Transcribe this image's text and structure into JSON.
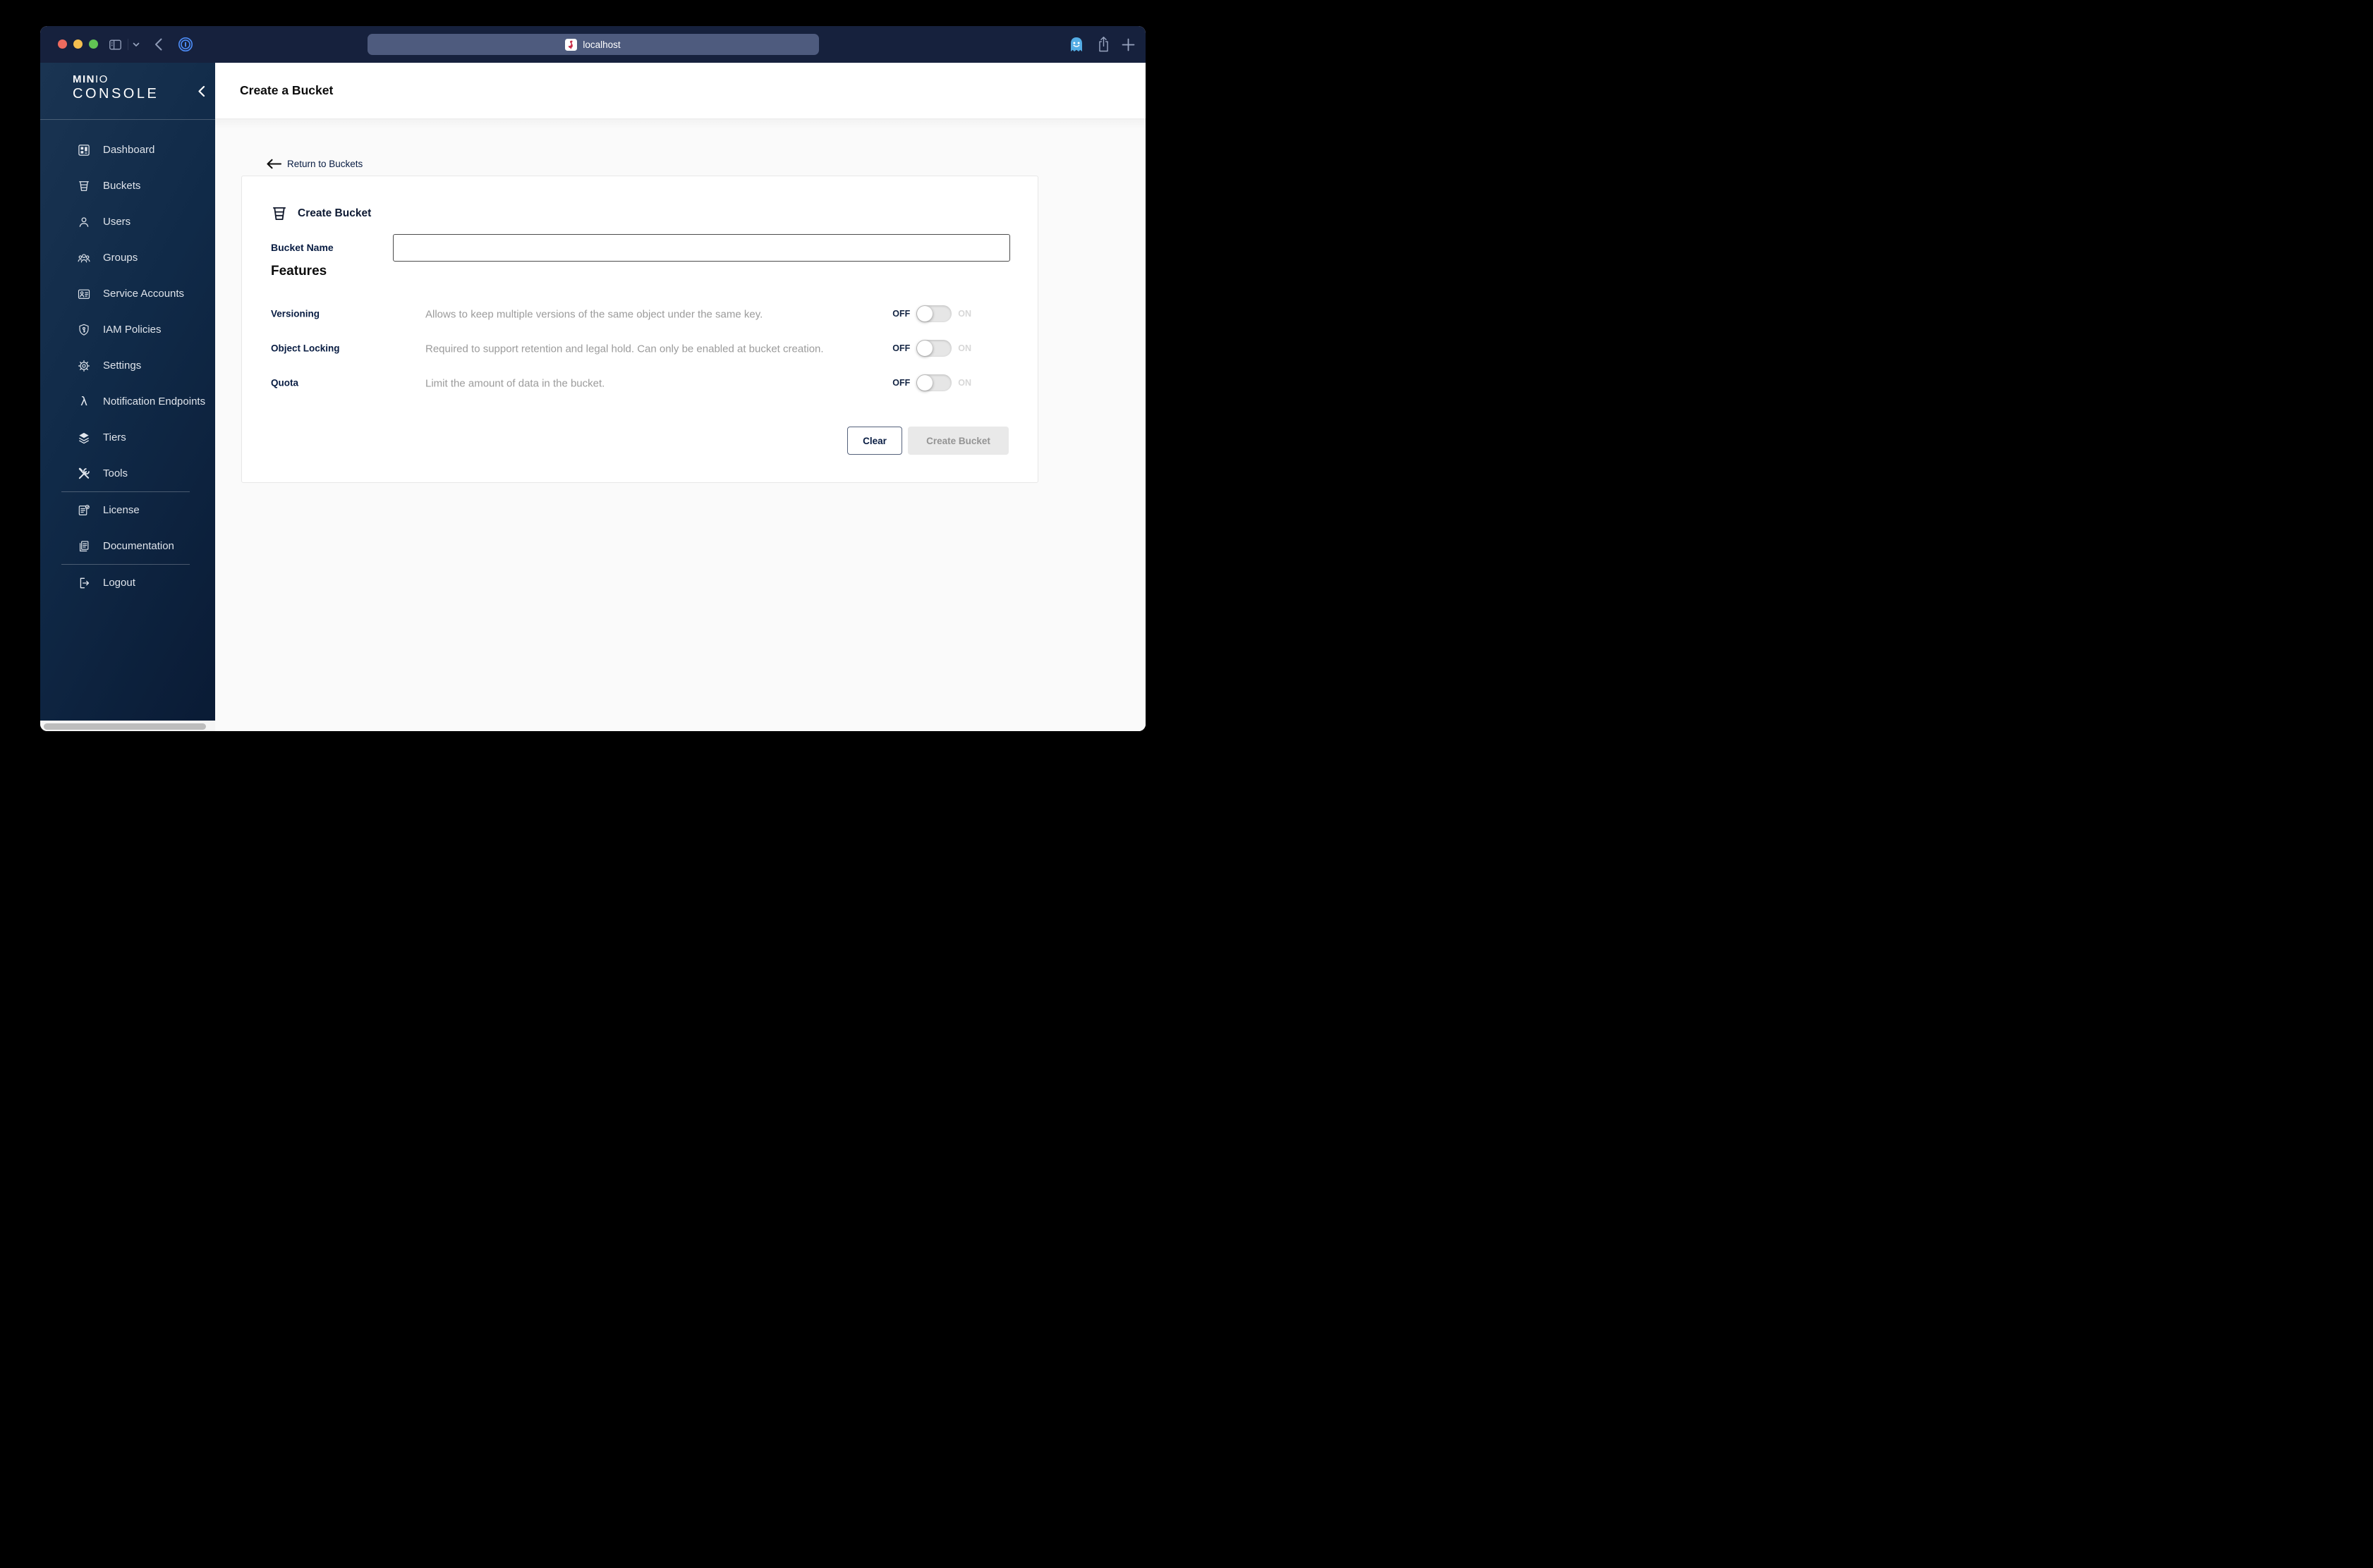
{
  "browser": {
    "address": "localhost",
    "icons": [
      "sidebar-toggle-icon",
      "chevron-down-icon",
      "back-icon",
      "onepassword-icon",
      "site-favicon",
      "ghostery-icon",
      "share-icon",
      "new-tab-icon"
    ],
    "window_controls": [
      "close",
      "minimize",
      "zoom"
    ]
  },
  "colors": {
    "navy": "#081C42",
    "minio_red": "#C72E49",
    "titlebar": "#16213D",
    "sidebar_gradient_start": "#1A3452",
    "sidebar_gradient_end": "#0A1B35",
    "content_bg": "#FAFAFA",
    "disabled_button_bg": "#E9E9E9",
    "description_gray": "#9B9B9B"
  },
  "sidebar": {
    "logo": {
      "brand_bold": "MIN",
      "brand_light": "IO",
      "product": "CONSOLE"
    },
    "items": [
      {
        "label": "Dashboard",
        "icon": "dashboard-icon"
      },
      {
        "label": "Buckets",
        "icon": "buckets-icon"
      },
      {
        "label": "Users",
        "icon": "users-icon"
      },
      {
        "label": "Groups",
        "icon": "groups-icon"
      },
      {
        "label": "Service Accounts",
        "icon": "service-accounts-icon"
      },
      {
        "label": "IAM Policies",
        "icon": "iam-policies-icon"
      },
      {
        "label": "Settings",
        "icon": "settings-icon"
      },
      {
        "label": "Notification Endpoints",
        "icon": "notification-endpoints-icon"
      },
      {
        "label": "Tiers",
        "icon": "tiers-icon"
      },
      {
        "label": "Tools",
        "icon": "tools-icon"
      },
      {
        "label": "License",
        "icon": "license-icon"
      },
      {
        "label": "Documentation",
        "icon": "documentation-icon"
      },
      {
        "label": "Logout",
        "icon": "logout-icon"
      }
    ]
  },
  "header": {
    "title": "Create a Bucket"
  },
  "page": {
    "back_link": "Return to Buckets",
    "card": {
      "title": "Create Bucket",
      "bucket_name_label": "Bucket Name",
      "bucket_name_value": "",
      "features_heading": "Features",
      "features": [
        {
          "name": "Versioning",
          "description": "Allows to keep multiple versions of the same object under the same key.",
          "off_label": "OFF",
          "on_label": "ON",
          "enabled": false
        },
        {
          "name": "Object Locking",
          "description": "Required to support retention and legal hold. Can only be enabled at bucket creation.",
          "off_label": "OFF",
          "on_label": "ON",
          "enabled": false
        },
        {
          "name": "Quota",
          "description": "Limit the amount of data in the bucket.",
          "off_label": "OFF",
          "on_label": "ON",
          "enabled": false
        }
      ],
      "buttons": {
        "clear": "Clear",
        "create": "Create Bucket"
      }
    }
  }
}
